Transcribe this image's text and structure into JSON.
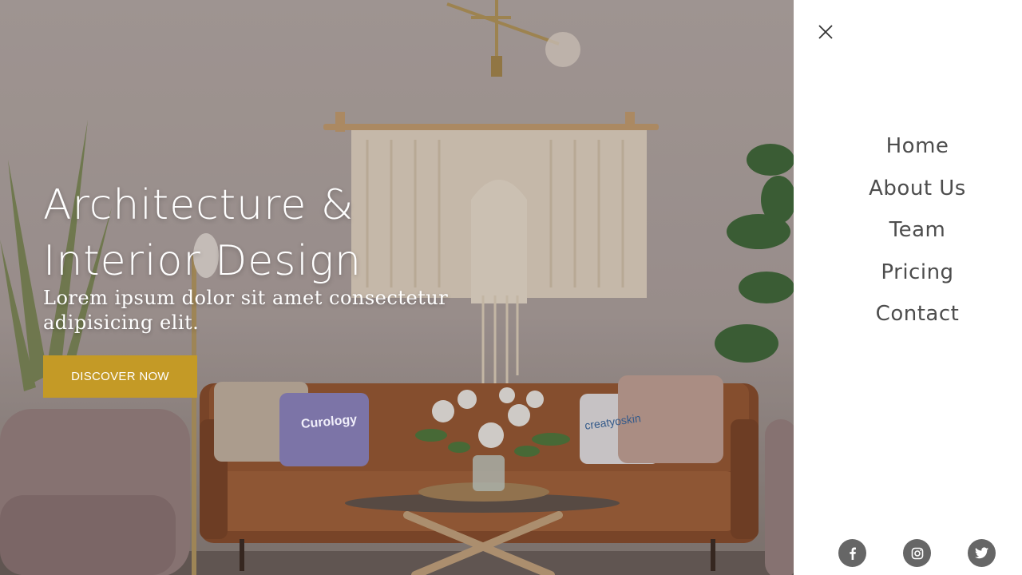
{
  "hero": {
    "title_line1": "Architecture &",
    "title_line2": "Interior Design",
    "subtitle": "Lorem ipsum dolor sit amet consectetur adipisicing elit.",
    "button_label": "DISCOVER NOW",
    "pillow_left_text": "Curology",
    "pillow_right_text": "creatyoskin"
  },
  "menu": {
    "items": [
      {
        "label": "Home"
      },
      {
        "label": "About Us"
      },
      {
        "label": "Team"
      },
      {
        "label": "Pricing"
      },
      {
        "label": "Contact"
      }
    ],
    "social": [
      "facebook-icon",
      "instagram-icon",
      "twitter-icon"
    ]
  },
  "colors": {
    "accent": "#c49a26",
    "menu_text": "#4d4d4d",
    "social_bg": "#666666"
  }
}
